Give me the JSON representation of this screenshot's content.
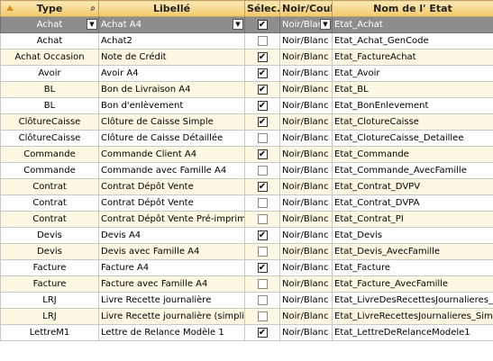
{
  "columns": [
    "Type",
    "Libellé",
    "Sélec.",
    "Noir/Coul.",
    "Nom de l' Etat"
  ],
  "filter": {
    "type": "Achat",
    "libelle": "Achat A4",
    "selec": true,
    "noir": "Noir/Blanc",
    "nom": "Etat_Achat"
  },
  "rows": [
    {
      "type": "Achat",
      "libelle": "Achat2",
      "selec": false,
      "noir": "Noir/Blanc",
      "nom": "Etat_Achat_GenCode"
    },
    {
      "type": "Achat Occasion",
      "libelle": "Note de Crédit",
      "selec": true,
      "noir": "Noir/Blanc",
      "nom": "Etat_FactureAchat"
    },
    {
      "type": "Avoir",
      "libelle": "Avoir A4",
      "selec": true,
      "noir": "Noir/Blanc",
      "nom": "Etat_Avoir"
    },
    {
      "type": "BL",
      "libelle": "Bon de Livraison A4",
      "selec": true,
      "noir": "Noir/Blanc",
      "nom": "Etat_BL"
    },
    {
      "type": "BL",
      "libelle": "Bon d'enlèvement",
      "selec": true,
      "noir": "Noir/Blanc",
      "nom": "Etat_BonEnlevement"
    },
    {
      "type": "ClôtureCaisse",
      "libelle": "Clôture de Caisse Simple",
      "selec": true,
      "noir": "Noir/Blanc",
      "nom": "Etat_ClotureCaisse"
    },
    {
      "type": "ClôtureCaisse",
      "libelle": "Clôture de Caisse Détaillée",
      "selec": false,
      "noir": "Noir/Blanc",
      "nom": "Etat_ClotureCaisse_Detaillee"
    },
    {
      "type": "Commande",
      "libelle": "Commande Client A4",
      "selec": true,
      "noir": "Noir/Blanc",
      "nom": "Etat_Commande"
    },
    {
      "type": "Commande",
      "libelle": "Commande avec Famille A4",
      "selec": false,
      "noir": "Noir/Blanc",
      "nom": "Etat_Commande_AvecFamille"
    },
    {
      "type": "Contrat",
      "libelle": "Contrat Dépôt Vente",
      "selec": true,
      "noir": "Noir/Blanc",
      "nom": "Etat_Contrat_DVPV"
    },
    {
      "type": "Contrat",
      "libelle": "Contrat Dépôt Vente",
      "selec": false,
      "noir": "Noir/Blanc",
      "nom": "Etat_Contrat_DVPA"
    },
    {
      "type": "Contrat",
      "libelle": "Contrat Dépôt Vente Pré-imprimé",
      "selec": false,
      "noir": "Noir/Blanc",
      "nom": "Etat_Contrat_PI"
    },
    {
      "type": "Devis",
      "libelle": "Devis A4",
      "selec": true,
      "noir": "Noir/Blanc",
      "nom": "Etat_Devis"
    },
    {
      "type": "Devis",
      "libelle": "Devis avec Famille A4",
      "selec": false,
      "noir": "Noir/Blanc",
      "nom": "Etat_Devis_AvecFamille"
    },
    {
      "type": "Facture",
      "libelle": "Facture A4",
      "selec": true,
      "noir": "Noir/Blanc",
      "nom": "Etat_Facture"
    },
    {
      "type": "Facture",
      "libelle": "Facture avec Famille A4",
      "selec": false,
      "noir": "Noir/Blanc",
      "nom": "Etat_Facture_AvecFamille"
    },
    {
      "type": "LRJ",
      "libelle": "Livre Recette journalière",
      "selec": false,
      "noir": "Noir/Blanc",
      "nom": "Etat_LivreDesRecettesJournalieres_"
    },
    {
      "type": "LRJ",
      "libelle": "Livre Recette journalière (simplifié",
      "selec": false,
      "noir": "Noir/Blanc",
      "nom": "Etat_LivreRecettesJournalieres_Sim"
    },
    {
      "type": "LettreM1",
      "libelle": "Lettre de Relance Modèle 1",
      "selec": true,
      "noir": "Noir/Blanc",
      "nom": "Etat_LettreDeRelanceModele1"
    }
  ],
  "icons": {
    "sort": "sort-ascending-icon",
    "search": "magnifier-icon",
    "dropdown": "dropdown-arrow-icon",
    "check": "checkbox-icon"
  },
  "colors": {
    "header": "#f2c96a",
    "row_alt": "#fdf8e1",
    "filter": "#8d8d8d",
    "sort_arrow": "#e08a10"
  }
}
